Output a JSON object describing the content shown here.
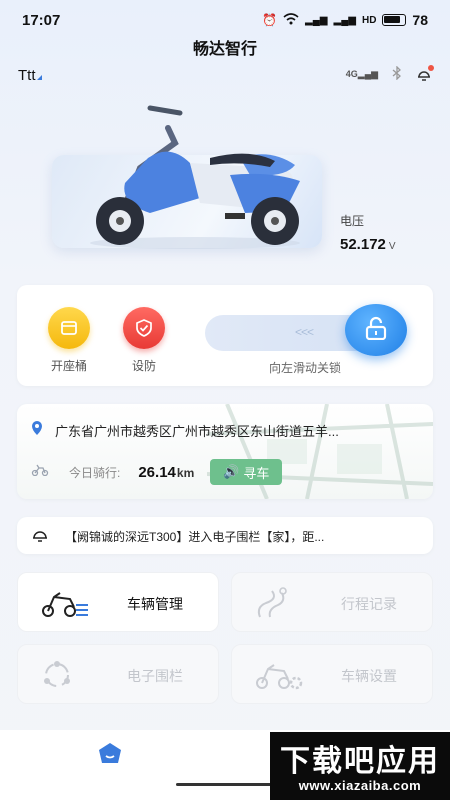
{
  "status": {
    "time": "17:07",
    "network": "HD",
    "battery": "78"
  },
  "app": {
    "title": "畅达智行"
  },
  "user": {
    "name": "Ttt"
  },
  "top_icons": [
    "4g-signal-icon",
    "bluetooth-icon",
    "message-icon"
  ],
  "vehicle": {
    "voltage_label": "电压",
    "voltage_value": "52.172",
    "voltage_unit": "V"
  },
  "controls": {
    "seat_label": "开座桶",
    "arm_label": "设防",
    "slider_arrows": "<<<",
    "slider_text": "向左滑动关锁"
  },
  "location": {
    "address": "广东省广州市越秀区广州市越秀区东山街道五羊...",
    "ride_label": "今日骑行:",
    "ride_value": "26.14",
    "ride_unit": "km",
    "find_label": "寻车"
  },
  "notice": {
    "text": "【阙锦诚的深远T300】进入电子围栏【家】，距..."
  },
  "tiles": [
    {
      "label": "车辆管理",
      "icon": "scooter-list-icon",
      "enabled": true
    },
    {
      "label": "行程记录",
      "icon": "route-icon",
      "enabled": false
    },
    {
      "label": "电子围栏",
      "icon": "fence-icon",
      "enabled": false
    },
    {
      "label": "车辆设置",
      "icon": "scooter-settings-icon",
      "enabled": false
    }
  ],
  "watermark": {
    "title": "下载吧应用",
    "url": "www.xiazaiba.com"
  },
  "colors": {
    "accent": "#1f7fe6",
    "find_button": "#6ec08d",
    "seat": "#f5b80d",
    "arm": "#e83a35"
  }
}
